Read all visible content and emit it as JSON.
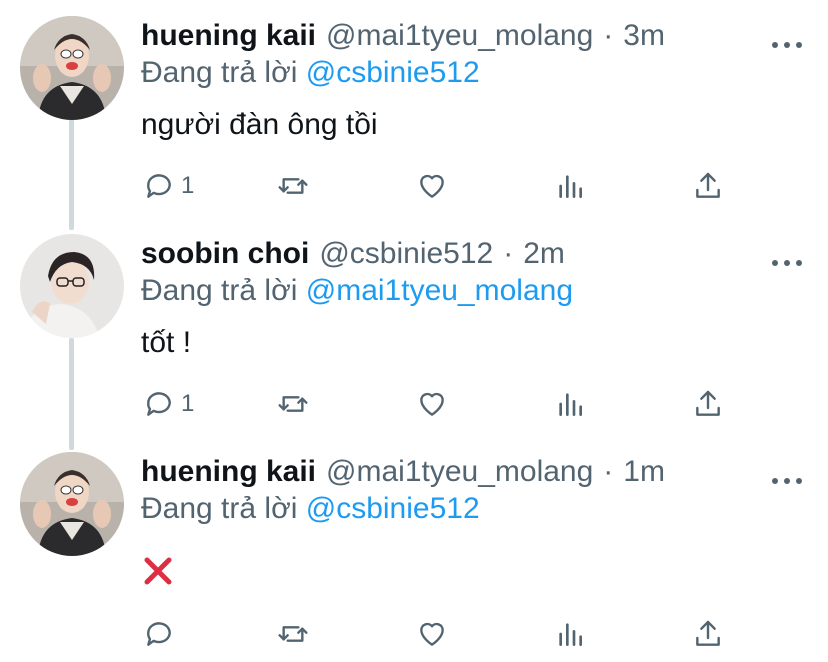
{
  "colors": {
    "text": "#0f1419",
    "secondary": "#536471",
    "link": "#1d9bf0",
    "thread_line": "#cfd9de",
    "x_mark": "#dd2e44"
  },
  "tweets": [
    {
      "name": "huening kaii",
      "handle": "@mai1tyeu_molang",
      "separator": "·",
      "time": "3m",
      "replying_prefix": "Đang trả lời",
      "replying_to": "@csbinie512",
      "text": "người đàn ông tồi",
      "reply_count": "1",
      "avatar_icon": "avatar-huening-kaii"
    },
    {
      "name": "soobin choi",
      "handle": "@csbinie512",
      "separator": "·",
      "time": "2m",
      "replying_prefix": "Đang trả lời",
      "replying_to": "@mai1tyeu_molang",
      "text": "tốt !",
      "reply_count": "1",
      "avatar_icon": "avatar-soobin-choi"
    },
    {
      "name": "huening kaii",
      "handle": "@mai1tyeu_molang",
      "separator": "·",
      "time": "1m",
      "replying_prefix": "Đang trả lời",
      "replying_to": "@csbinie512",
      "text_icon": "cross-mark-emoji",
      "reply_count": "",
      "avatar_icon": "avatar-huening-kaii"
    }
  ],
  "icons": [
    "reply-icon",
    "retweet-icon",
    "like-icon",
    "analytics-icon",
    "share-icon",
    "more-icon"
  ]
}
